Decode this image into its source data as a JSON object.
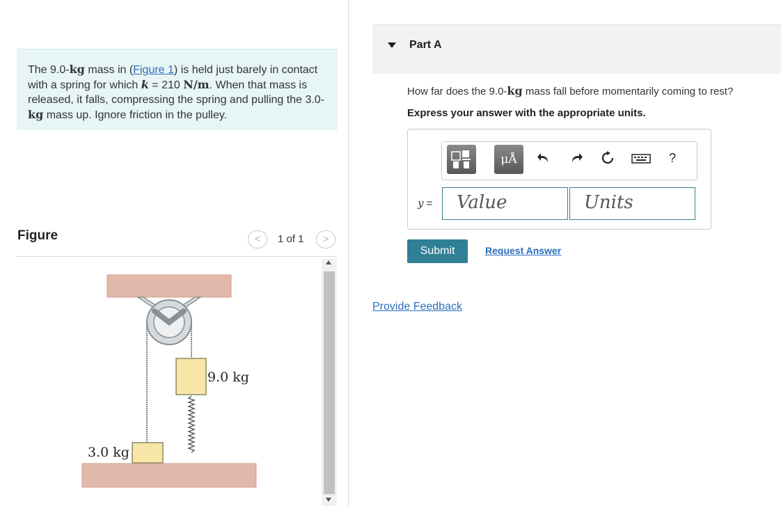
{
  "problem": {
    "seg1": "The 9.0-",
    "unit_kg_1": "kg",
    "seg2": " mass in (",
    "figure_link": "Figure 1",
    "seg3": ") is held just barely in contact with a spring for which ",
    "k_symbol": "k",
    "seg4": " = 210 ",
    "unit_nm": "N/m",
    "seg5": ". When that mass is released, it falls, compressing the spring and pulling the 3.0-",
    "unit_kg_2": "kg",
    "seg6": " mass up. Ignore friction in the pulley."
  },
  "figure_panel": {
    "title": "Figure",
    "count": "1 of 1",
    "prev": "<",
    "next": ">",
    "mass_right_label": "9.0 kg",
    "mass_left_label": "3.0 kg"
  },
  "part": {
    "title": "Part A"
  },
  "question": {
    "q1": "How far does the 9.0-",
    "unit_kg": "kg",
    "q2": " mass fall before momentarily coming to rest?",
    "instruction": "Express your answer with the appropriate units."
  },
  "answer": {
    "units_button": "μÅ",
    "help": "?",
    "var": "y",
    "eq": " =",
    "value_placeholder": "Value",
    "units_placeholder": "Units"
  },
  "actions": {
    "submit": "Submit",
    "request_answer": "Request Answer",
    "provide_feedback": "Provide Feedback"
  },
  "colors": {
    "accent": "#2f7f96",
    "link": "#2a6ebb",
    "problem_bg": "#e8f5f6",
    "ceiling_floor": "#e2b8aa",
    "mass_fill": "#f8e6a8"
  }
}
